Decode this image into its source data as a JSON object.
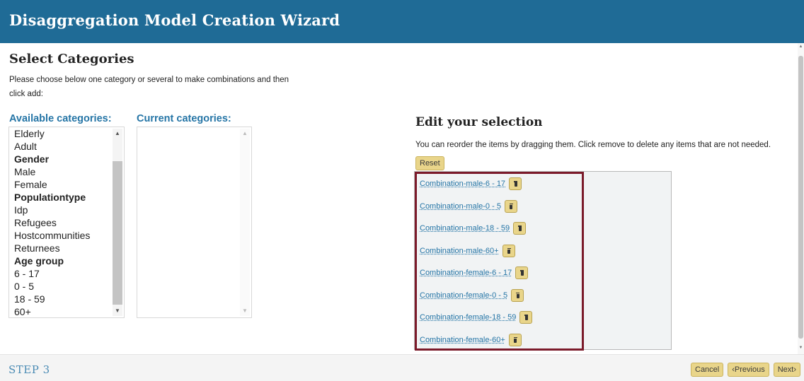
{
  "header": {
    "title": "Disaggregation Model Creation Wizard"
  },
  "select_categories": {
    "title": "Select Categories",
    "intro": "Please choose below one category or several to make combinations and then click add:",
    "available_label": "Available categories:",
    "current_label": "Current categories:",
    "available_items": [
      {
        "label": "Elderly",
        "group": false
      },
      {
        "label": "Adult",
        "group": false
      },
      {
        "label": "Gender",
        "group": true
      },
      {
        "label": "Male",
        "group": false
      },
      {
        "label": "Female",
        "group": false
      },
      {
        "label": "Populationtype",
        "group": true
      },
      {
        "label": "Idp",
        "group": false
      },
      {
        "label": "Refugees",
        "group": false
      },
      {
        "label": "Hostcommunities",
        "group": false
      },
      {
        "label": "Returnees",
        "group": false
      },
      {
        "label": "Age group",
        "group": true
      },
      {
        "label": "6 - 17",
        "group": false
      },
      {
        "label": "0 - 5",
        "group": false
      },
      {
        "label": "18 - 59",
        "group": false
      },
      {
        "label": "60+",
        "group": false
      }
    ],
    "current_items": []
  },
  "edit_selection": {
    "title": "Edit your selection",
    "description": "You can reorder the items by dragging them. Click remove to delete any items that are not needed.",
    "reset_label": "Reset",
    "items": [
      "Combination-male-6 - 17",
      "Combination-male-0 - 5",
      "Combination-male-18 - 59",
      "Combination-male-60+",
      "Combination-female-6 - 17",
      "Combination-female-0 - 5",
      "Combination-female-18 - 59",
      "Combination-female-60+"
    ]
  },
  "footer": {
    "step": "STEP 3",
    "cancel_label": "Cancel",
    "previous_label": "‹Previous",
    "next_label": "Next›"
  },
  "colors": {
    "header_bg": "#1f6b96",
    "accent_link": "#2575a6",
    "button_bg": "#e9d58a",
    "selection_border": "#7b1a2a"
  }
}
